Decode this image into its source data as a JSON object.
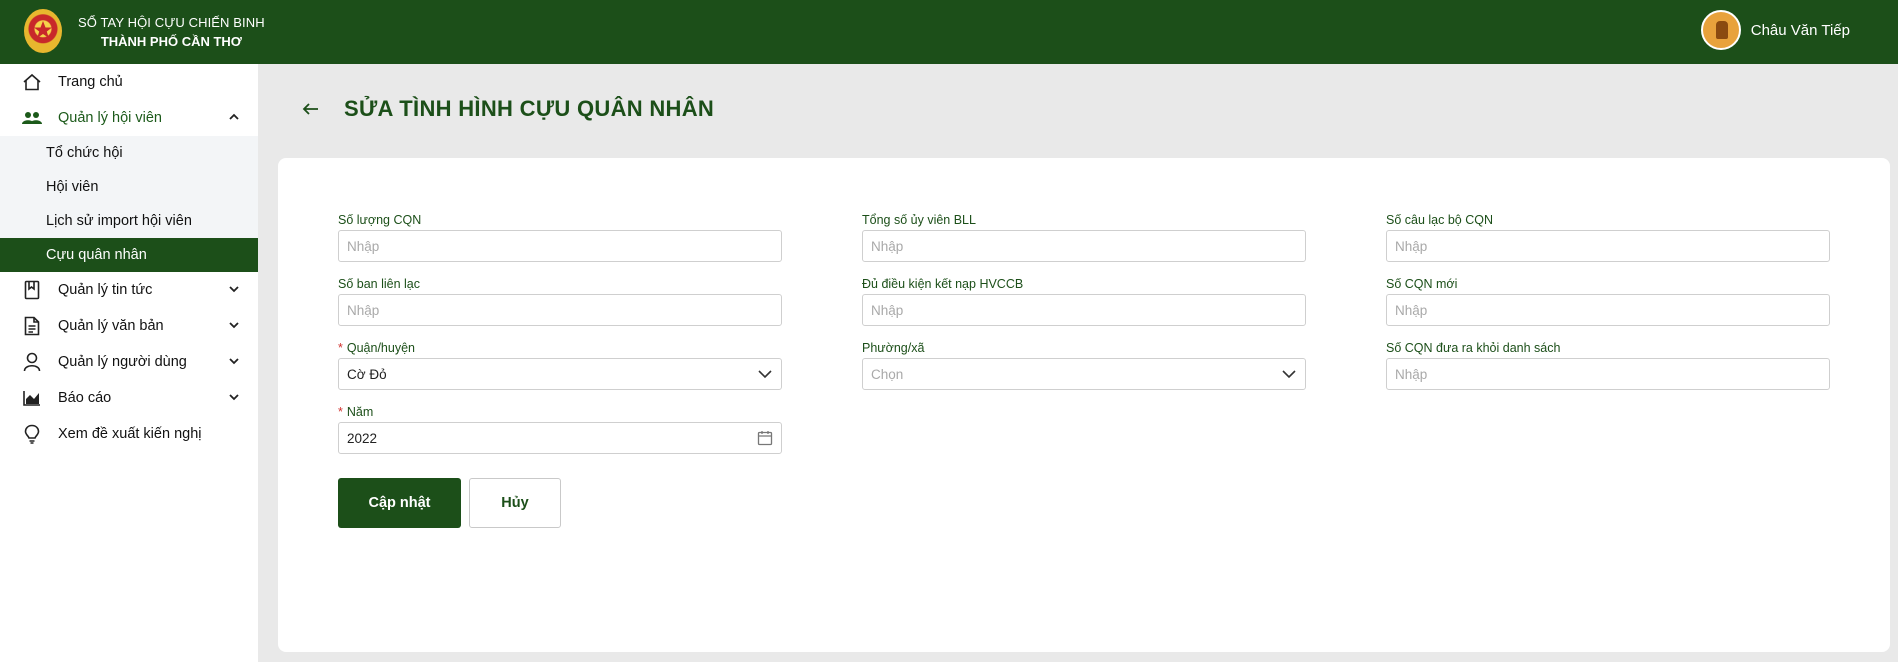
{
  "header": {
    "brand_line1": "SỔ TAY HỘI CỰU CHIẾN BINH",
    "brand_line2": "THÀNH PHỐ CẦN THƠ",
    "user_name": "Châu Văn Tiếp",
    "bg_color": "#1c4f19"
  },
  "sidebar": {
    "items": [
      {
        "label": "Trang chủ",
        "icon": "home-icon"
      },
      {
        "label": "Quản lý hội viên",
        "icon": "users-icon",
        "expanded": true
      },
      {
        "label": "Quản lý tin tức",
        "icon": "bookmark-icon"
      },
      {
        "label": "Quản lý văn bản",
        "icon": "document-icon"
      },
      {
        "label": "Quản lý người dùng",
        "icon": "user-icon"
      },
      {
        "label": "Báo cáo",
        "icon": "chart-icon"
      },
      {
        "label": "Xem đề xuất kiến nghị",
        "icon": "lightbulb-icon"
      }
    ],
    "sub_items": [
      {
        "label": "Tổ chức hội"
      },
      {
        "label": "Hội viên"
      },
      {
        "label": "Lịch sử import hội viên"
      },
      {
        "label": "Cựu quân nhân",
        "selected": true
      }
    ]
  },
  "page": {
    "title": "SỬA TÌNH HÌNH CỰU QUÂN NHÂN"
  },
  "form": {
    "so_luong_cqn": {
      "label": "Số lượng CQN",
      "placeholder": "Nhập",
      "value": ""
    },
    "tong_so_uy_vien": {
      "label": "Tổng số ủy viên BLL",
      "placeholder": "Nhập",
      "value": ""
    },
    "so_cau_lac_bo": {
      "label": "Số câu lạc bộ CQN",
      "placeholder": "Nhập",
      "value": ""
    },
    "so_ban_lien_lac": {
      "label": "Số ban liên lạc",
      "placeholder": "Nhập",
      "value": ""
    },
    "du_dieu_kien": {
      "label": "Đủ điều kiện kết nạp HVCCB",
      "placeholder": "Nhập",
      "value": ""
    },
    "so_cqn_moi": {
      "label": "Số CQN mới",
      "placeholder": "Nhập",
      "value": ""
    },
    "quan_huyen": {
      "label": "Quận/huyện",
      "required_mark": "*",
      "value": "Cờ Đỏ"
    },
    "phuong_xa": {
      "label": "Phường/xã",
      "placeholder": "Chọn"
    },
    "so_cqn_dua_ra": {
      "label": "Số CQN đưa ra khỏi danh sách",
      "placeholder": "Nhập",
      "value": ""
    },
    "nam": {
      "label": "Năm",
      "required_mark": "*",
      "value": "2022"
    }
  },
  "buttons": {
    "update": "Cập nhật",
    "cancel": "Hủy"
  }
}
